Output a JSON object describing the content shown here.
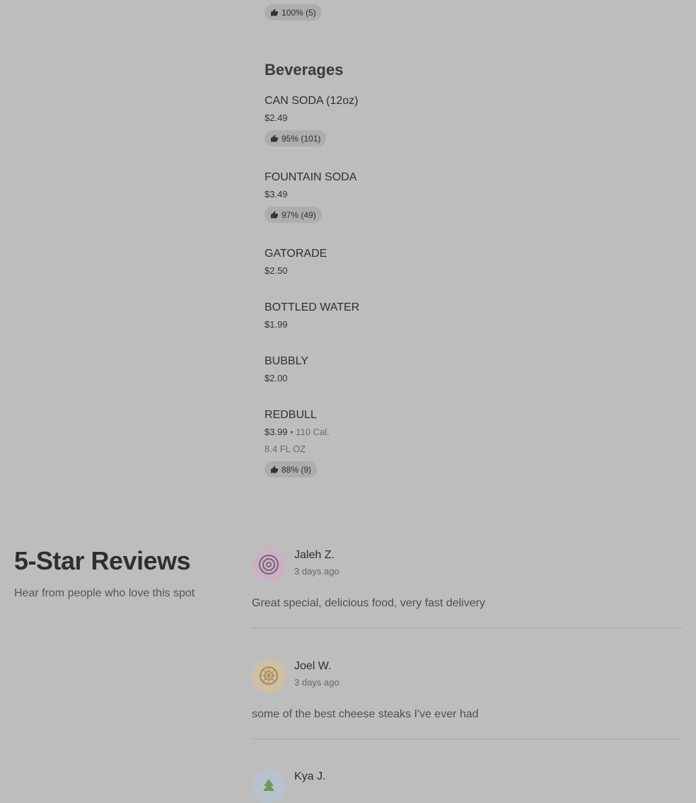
{
  "top_item": {
    "rating": "100% (5)"
  },
  "beverages": {
    "title": "Beverages",
    "items": [
      {
        "name": "CAN SODA (12oz)",
        "price": "$2.49",
        "rating": "95% (101)"
      },
      {
        "name": "FOUNTAIN SODA",
        "price": "$3.49",
        "rating": "97% (49)"
      },
      {
        "name": "GATORADE",
        "price": "$2.50"
      },
      {
        "name": "BOTTLED WATER",
        "price": "$1.99"
      },
      {
        "name": "BUBBLY",
        "price": "$2.00"
      },
      {
        "name": "REDBULL",
        "price": "$3.99",
        "calories": "• 110 Cal.",
        "description": "8.4 FL OZ",
        "rating": "88% (9)"
      }
    ]
  },
  "reviews": {
    "heading": "5-Star Reviews",
    "subheading": "Hear from people who love this spot",
    "items": [
      {
        "name": "Jaleh Z.",
        "date": "3 days ago",
        "text": "Great special, delicious food, very fast delivery",
        "avatar_icon": "target-icon",
        "avatar_color": "#c9b3c3"
      },
      {
        "name": "Joel W.",
        "date": "3 days ago",
        "text": "some of the best cheese steaks I've ever had",
        "avatar_icon": "citrus-icon",
        "avatar_color": "#cfc0a4"
      },
      {
        "name": "Kya J.",
        "avatar_icon": "tree-icon",
        "avatar_color": "#b7c3cc"
      }
    ]
  },
  "icons": {
    "rating": "thumbs-up-icon"
  }
}
